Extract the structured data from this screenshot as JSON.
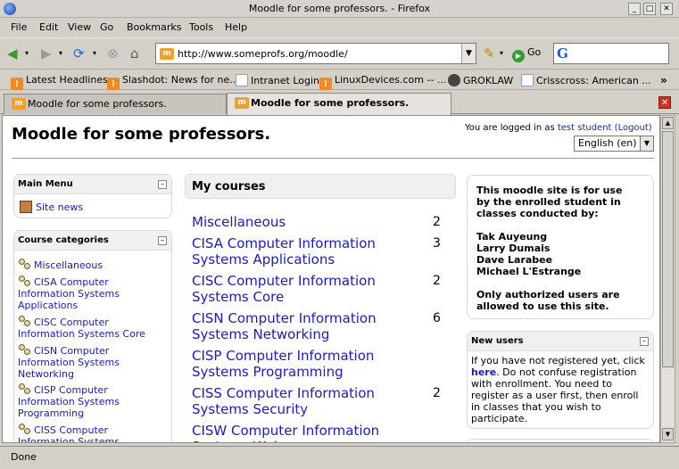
{
  "window": {
    "title": "Moodle for some professors. - Firefox"
  },
  "menu": [
    "File",
    "Edit",
    "View",
    "Go",
    "Bookmarks",
    "Tools",
    "Help"
  ],
  "nav": {
    "url": "http://www.someprofs.org/moodle/",
    "go_label": "Go"
  },
  "bookmarks": [
    "Latest Headlines",
    "Slashdot: News for ne...",
    "Intranet Login",
    "LinuxDevices.com -- ...",
    "GROKLAW",
    "Crisscross: American ..."
  ],
  "tabs": [
    "Moodle for some professors.",
    "Moodle for some professors."
  ],
  "page": {
    "title": "Moodle for some professors.",
    "login_prefix": "You are logged in as",
    "login_user": "test student",
    "logout": "(Logout)",
    "language": "English (en)"
  },
  "main_menu": {
    "title": "Main Menu",
    "items": [
      "Site news"
    ]
  },
  "categories": {
    "title": "Course categories",
    "items": [
      "Miscellaneous",
      "CISA Computer Information Systems Applications",
      "CISC Computer Information Systems Core",
      "CISN Computer Information Systems Networking",
      "CISP Computer Information Systems Programming",
      "CISS Computer Information Systems"
    ]
  },
  "my_courses": {
    "title": "My courses",
    "items": [
      {
        "name": "Miscellaneous",
        "count": "2"
      },
      {
        "name": "CISA Computer Information Systems Applications",
        "count": "3"
      },
      {
        "name": "CISC Computer Information Systems Core",
        "count": "2"
      },
      {
        "name": "CISN Computer Information Systems Networking",
        "count": "6"
      },
      {
        "name": "CISP Computer Information Systems Programming",
        "count": ""
      },
      {
        "name": "CISS Computer Information Systems Security",
        "count": "2"
      },
      {
        "name": "CISW Computer Information Systems Web",
        "count": ""
      }
    ]
  },
  "info": {
    "intro": [
      "This moodle site is for use",
      "by the enrolled student in",
      "classes conducted by:"
    ],
    "teachers": [
      "Tak Auyeung",
      "Larry Dumais",
      "Dave Larabee",
      "Michael L'Estrange"
    ],
    "notice": [
      "Only authorized users are",
      "allowed to use this site."
    ]
  },
  "new_users": {
    "title": "New users",
    "before": "If you have not registered yet, click",
    "link": "here",
    "after": ". Do not confuse registration with enrollment. You need to register as a user first, then enroll in classes that you wish to participate."
  },
  "status": "Done"
}
